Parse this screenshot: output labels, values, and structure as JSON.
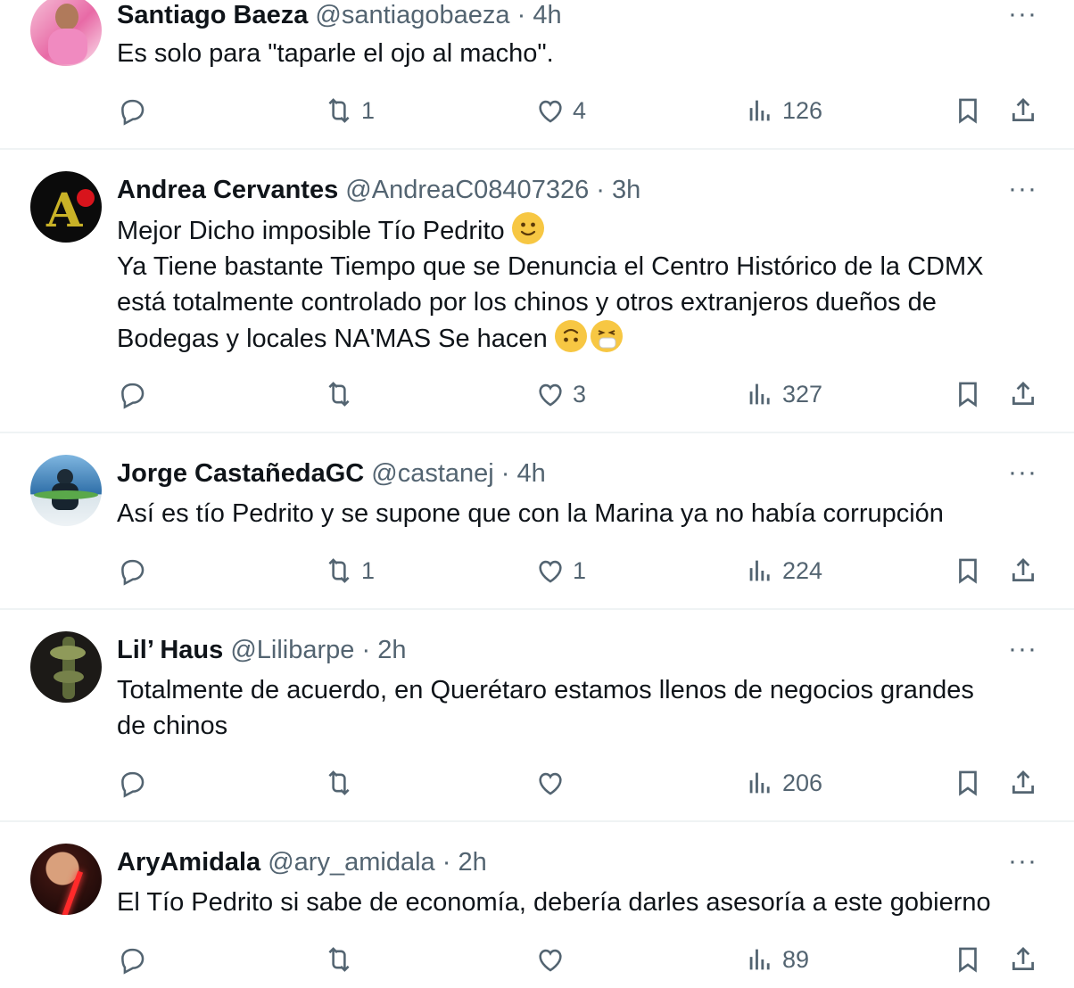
{
  "tweets": [
    {
      "name": "Santiago Baeza",
      "handle": "@santiagobaeza",
      "time": "4h",
      "lines": [
        "Es solo para \"taparle el ojo al macho\"."
      ],
      "stats": {
        "replies": "",
        "retweets": "1",
        "likes": "4",
        "views": "126"
      }
    },
    {
      "name": "Andrea Cervantes",
      "handle": "@AndreaC08407326",
      "time": "3h",
      "lines": [
        "Mejor Dicho imposible Tío Pedrito",
        "Ya Tiene bastante Tiempo que se Denuncia el Centro Histórico de la CDMX",
        "está totalmente controlado por los chinos y otros extranjeros dueños de",
        "Bodegas y locales NA'MAS Se hacen"
      ],
      "stats": {
        "replies": "",
        "retweets": "",
        "likes": "3",
        "views": "327"
      }
    },
    {
      "name": "Jorge CastañedaGC",
      "handle": "@castanej",
      "time": "4h",
      "lines": [
        "Así es tío Pedrito y se supone que con la Marina ya no había corrupción"
      ],
      "stats": {
        "replies": "",
        "retweets": "1",
        "likes": "1",
        "views": "224"
      }
    },
    {
      "name": "Lil’ Haus",
      "handle": "@Lilibarpe",
      "time": "2h",
      "lines": [
        "Totalmente de acuerdo, en Querétaro estamos llenos de negocios grandes",
        "de chinos"
      ],
      "stats": {
        "replies": "",
        "retweets": "",
        "likes": "",
        "views": "206"
      }
    },
    {
      "name": "AryAmidala",
      "handle": "@ary_amidala",
      "time": "2h",
      "lines": [
        "El Tío Pedrito si sabe de economía, debería darles asesoría a este gobierno"
      ],
      "stats": {
        "replies": "",
        "retweets": "",
        "likes": "",
        "views": "89"
      }
    }
  ],
  "ui": {
    "separator": "·",
    "more_label": "···"
  },
  "colors": {
    "muted": "#536471",
    "text": "#0f1419",
    "divider": "#eff3f4",
    "emoji": "#f7c743"
  }
}
